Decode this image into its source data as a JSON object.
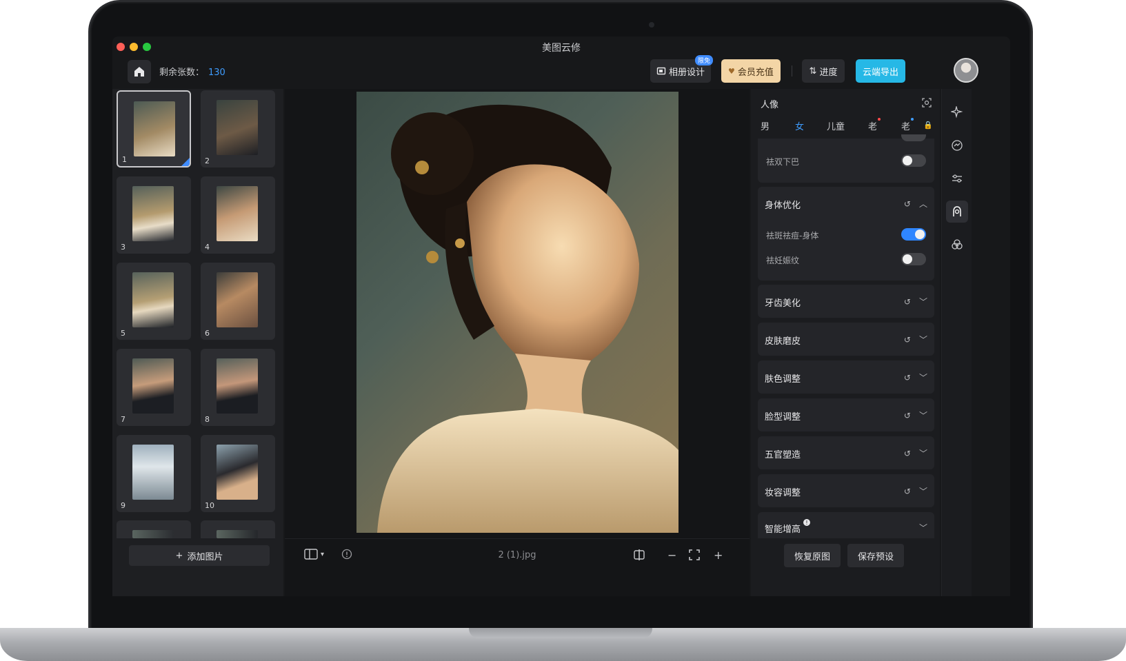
{
  "app": {
    "title": "美图云修"
  },
  "toolbar": {
    "remaining_label": "剩余张数：",
    "remaining_count": "130",
    "album_design": "相册设计",
    "album_badge": "限免",
    "member_recharge": "会员充值",
    "progress": "进度",
    "cloud_export": "云端导出"
  },
  "thumbnails": [
    {
      "index": "1",
      "selected": true
    },
    {
      "index": "2"
    },
    {
      "index": "3"
    },
    {
      "index": "4"
    },
    {
      "index": "5"
    },
    {
      "index": "6"
    },
    {
      "index": "7"
    },
    {
      "index": "8"
    },
    {
      "index": "9"
    },
    {
      "index": "10"
    }
  ],
  "left": {
    "add_image": "添加图片"
  },
  "canvas": {
    "file_name": "2 (1).jpg"
  },
  "right": {
    "portrait_title": "人像",
    "gender_tabs": [
      "男",
      "女",
      "儿童",
      "老",
      "老"
    ],
    "sections": {
      "double_chin": "祛双下巴",
      "body_opt": "身体优化",
      "body_items": [
        "祛斑祛痘-身体",
        "祛妊娠纹"
      ],
      "teeth": "牙齿美化",
      "skin_smooth": "皮肤磨皮",
      "skin_tone": "肤色调整",
      "face_shape": "脸型调整",
      "features": "五官塑造",
      "makeup": "妆容调整",
      "height": "智能增高"
    },
    "restore": "恢复原图",
    "save_preset": "保存预设"
  },
  "colors": {
    "accent": "#3f9dff",
    "export": "#26b8e6",
    "member": "#f3d5a6"
  }
}
